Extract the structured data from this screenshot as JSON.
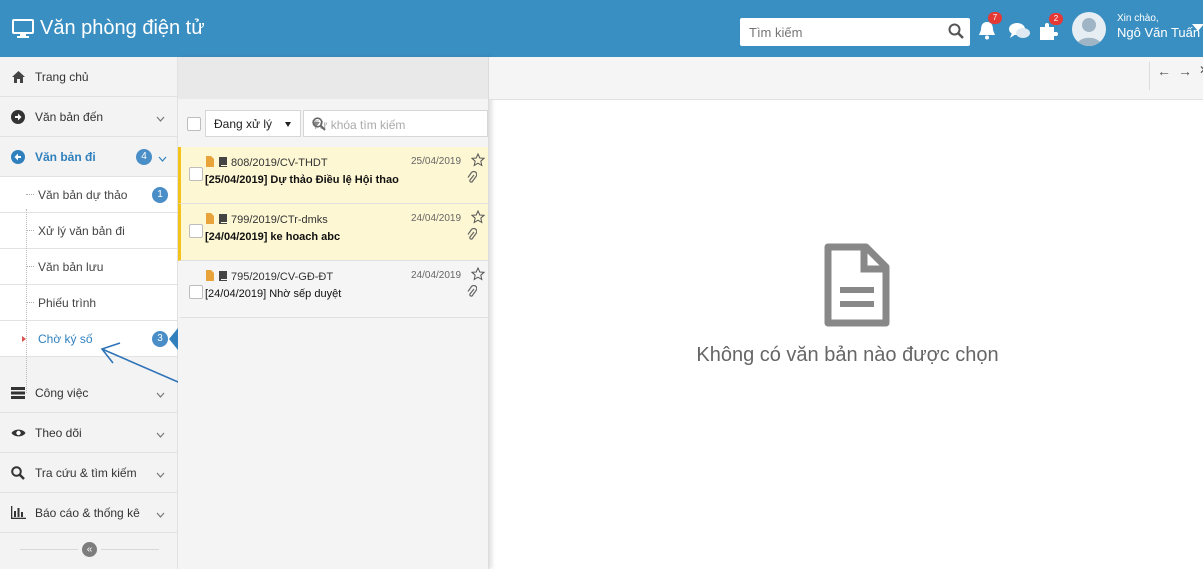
{
  "app": {
    "title": "Văn phòng điện tử"
  },
  "search": {
    "placeholder": "Tìm kiếm"
  },
  "notifications": {
    "bell_count": "7",
    "plugin_count": "2"
  },
  "user": {
    "greeting": "Xin chào,",
    "name": "Ngô Văn Tuấn"
  },
  "sidebar": {
    "items": [
      {
        "label": "Trang chủ",
        "icon": "home-icon"
      },
      {
        "label": "Văn bản đến",
        "icon": "arrow-right-circle-icon"
      },
      {
        "label": "Văn bản đi",
        "icon": "arrow-left-circle-icon",
        "badge": "4"
      },
      {
        "label": "Công việc",
        "icon": "tasks-icon"
      },
      {
        "label": "Theo dõi",
        "icon": "eye-icon"
      },
      {
        "label": "Tra cứu & tìm kiếm",
        "icon": "search-icon"
      },
      {
        "label": "Báo cáo & thống kê",
        "icon": "bar-chart-icon"
      }
    ],
    "sub_items": [
      {
        "label": "Văn bản dự thảo",
        "badge": "1"
      },
      {
        "label": "Xử lý văn bản đi"
      },
      {
        "label": "Văn bản lưu"
      },
      {
        "label": "Phiếu trình"
      },
      {
        "label": "Chờ ký số",
        "badge": "3"
      }
    ]
  },
  "filter": {
    "status": "Đang xử lý",
    "keyword_placeholder": "Từ khóa tìm kiếm"
  },
  "documents": [
    {
      "code": "808/2019/CV-THDT",
      "date": "25/04/2019",
      "title": "[25/04/2019] Dự thảo Điều lệ Hội thao"
    },
    {
      "code": "799/2019/CTr-dmks",
      "date": "24/04/2019",
      "title": "[24/04/2019] ke hoach abc"
    },
    {
      "code": "795/2019/CV-GĐ-ĐT",
      "date": "24/04/2019",
      "title": "[24/04/2019] Nhờ sếp duyệt"
    }
  ],
  "detail": {
    "empty_message": "Không có văn bản nào được chọn"
  },
  "colors": {
    "header": "#3a8fc2",
    "accent": "#2f80bd",
    "highlight": "#fdf7d3",
    "highlight_border": "#f3c21b",
    "badge": "#e53935"
  }
}
